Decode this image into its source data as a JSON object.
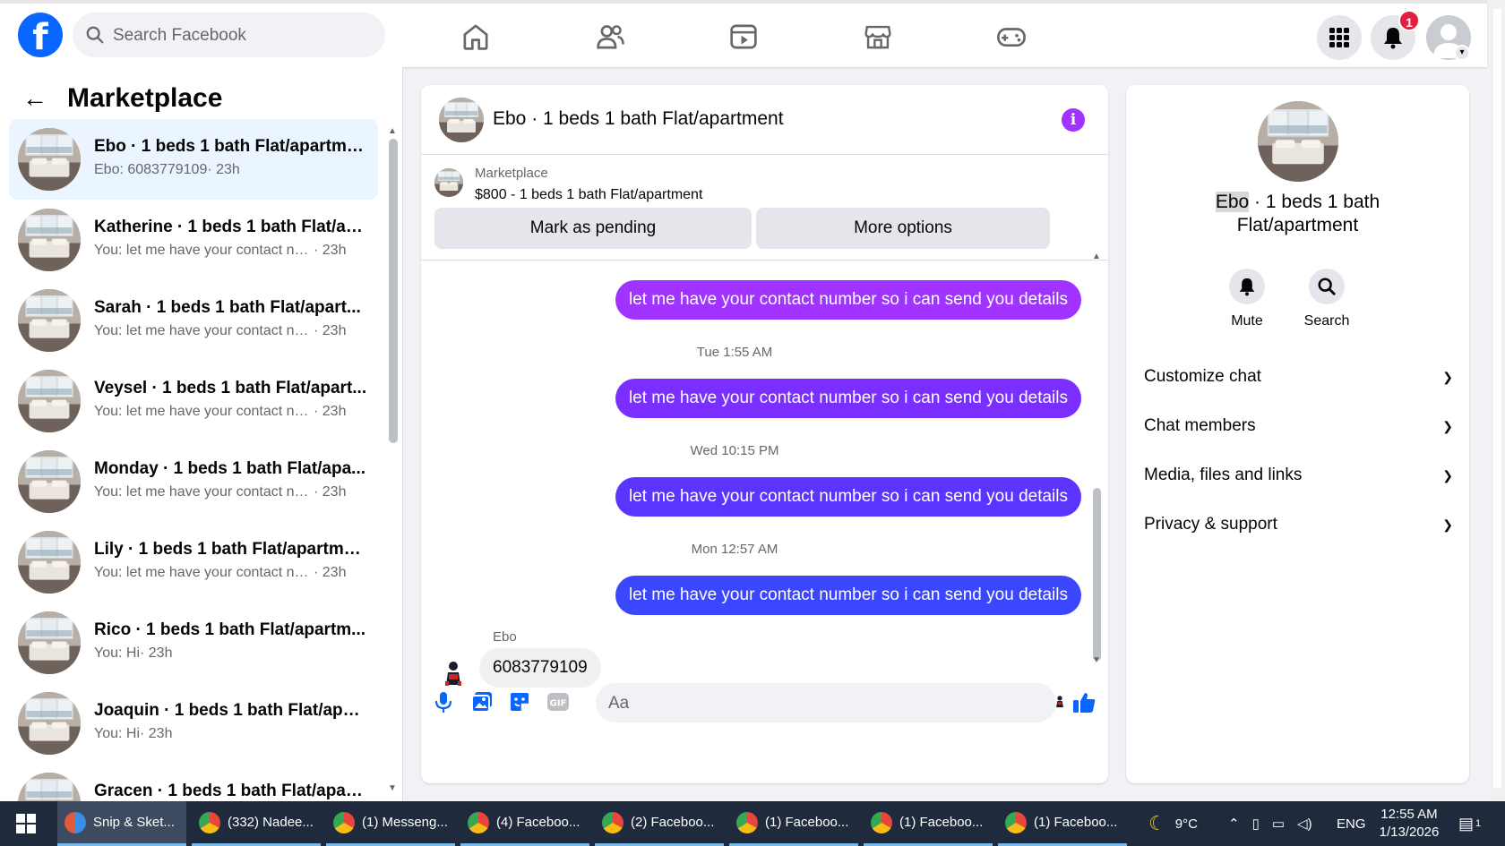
{
  "colors": {
    "facebook_blue": "#0866ff",
    "outgoing_purple": "#a033ff",
    "outgoing_indigo": "#6a2eff",
    "outgoing_blue": "#3b46ff",
    "active_conversation": "#ebf5ff"
  },
  "topbar": {
    "logo": "f",
    "search_placeholder": "Search Facebook",
    "nav_icons": [
      "home-icon",
      "friends-icon",
      "video-icon",
      "marketplace-icon",
      "gaming-icon"
    ],
    "notification_count": "1"
  },
  "sidebar": {
    "back_label": "←",
    "title": "Marketplace",
    "conversations": [
      {
        "title": "Ebo · 1 beds 1 bath Flat/apartment",
        "preview": "Ebo: 6083779109",
        "time": " · 23h",
        "active": true
      },
      {
        "title": "Katherine · 1 beds 1 bath Flat/ap...",
        "preview": "You: let me have your contact nu...",
        "time": " · 23h"
      },
      {
        "title": "Sarah · 1 beds 1 bath Flat/apart...",
        "preview": "You: let me have your contact nu...",
        "time": " · 23h"
      },
      {
        "title": "Veysel · 1 beds 1 bath Flat/apart...",
        "preview": "You: let me have your contact nu...",
        "time": " · 23h"
      },
      {
        "title": "Monday · 1 beds 1 bath Flat/apa...",
        "preview": "You: let me have your contact nu...",
        "time": " · 23h"
      },
      {
        "title": "Lily · 1 beds 1 bath Flat/apartment",
        "preview": "You: let me have your contact nu...",
        "time": " · 23h"
      },
      {
        "title": "Rico · 1 beds 1 bath Flat/apartm...",
        "preview": "You: Hi",
        "time": " · 23h"
      },
      {
        "title": "Joaquin · 1 beds 1 bath Flat/apar...",
        "preview": "You: Hi",
        "time": " · 23h"
      },
      {
        "title": "Gracen · 1 beds 1 bath Flat/apart...",
        "preview": "",
        "time": ""
      }
    ]
  },
  "chat": {
    "header_name": "Ebo · 1 beds 1 bath Flat/apartment",
    "info_label": "i",
    "marketplace_label": "Marketplace",
    "listing": "$800 - 1 beds 1 bath Flat/apartment",
    "mark_pending": "Mark as pending",
    "more_options": "More options",
    "outgoing_text": "let me have your contact number so i can send you details",
    "timestamps": [
      "Tue 1:55 AM",
      "Wed 10:15 PM",
      "Mon 12:57 AM"
    ],
    "sender": "Ebo",
    "incoming_text": "6083779109",
    "composer_placeholder": "Aa",
    "composer_icons": [
      "microphone-icon",
      "photo-icon",
      "sticker-icon",
      "gif-icon",
      "emoji-icon",
      "like-icon"
    ]
  },
  "details": {
    "title_name": "Ebo",
    "title_rest": " · 1 beds 1 bath",
    "title_line2": "Flat/apartment",
    "mute_label": "Mute",
    "search_label": "Search",
    "sections": [
      "Customize chat",
      "Chat members",
      "Media, files and links",
      "Privacy & support"
    ]
  },
  "taskbar": {
    "apps": [
      {
        "label": "Snip & Sket...",
        "active": true
      },
      {
        "label": "(332) Nadee..."
      },
      {
        "label": "(1) Messeng..."
      },
      {
        "label": "(4) Faceboo..."
      },
      {
        "label": "(2) Faceboo..."
      },
      {
        "label": "(1) Faceboo..."
      },
      {
        "label": "(1) Faceboo..."
      },
      {
        "label": "(1) Faceboo..."
      }
    ],
    "weather": "9°C",
    "language": "ENG",
    "time": "12:55 AM",
    "date": "1/13/2026",
    "notifications": "1"
  }
}
